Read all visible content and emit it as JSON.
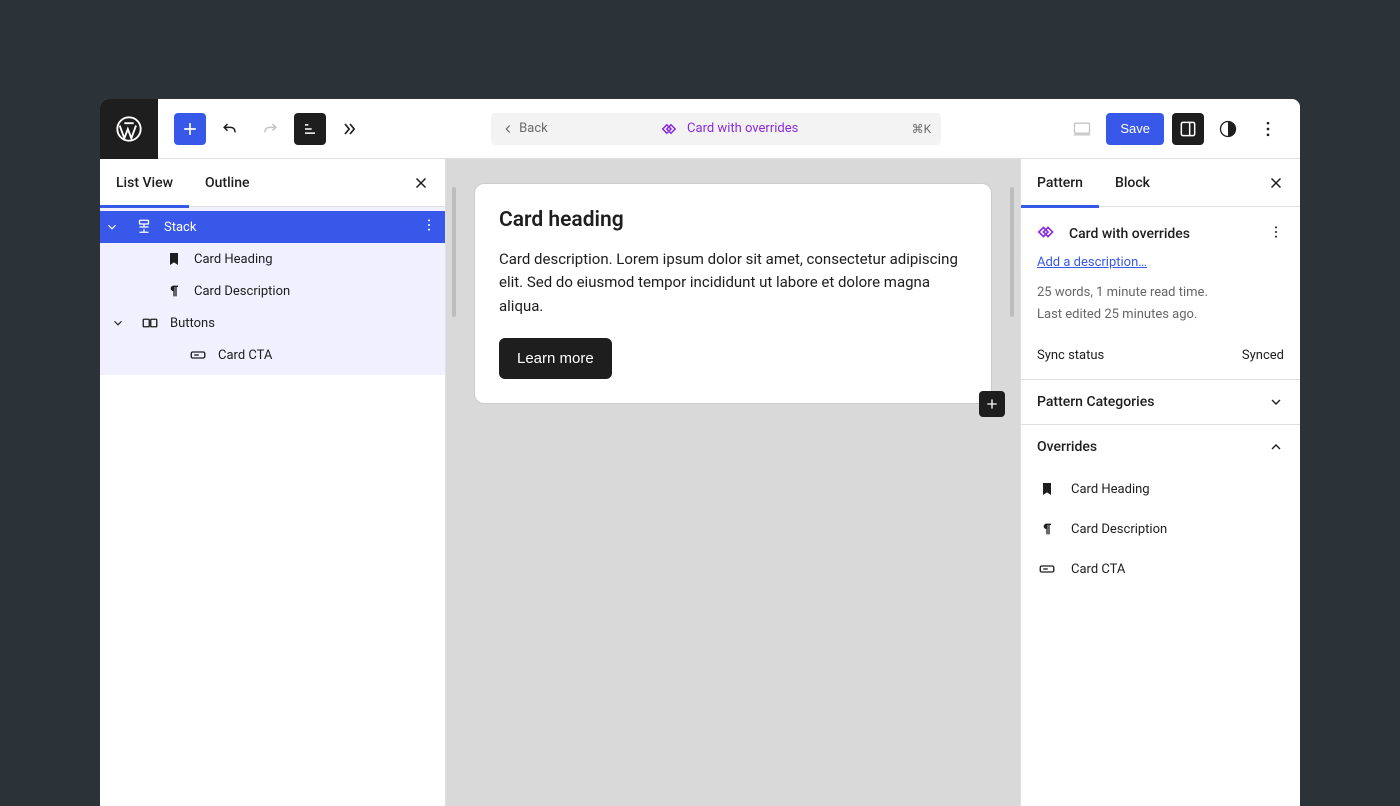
{
  "topbar": {
    "back_label": "Back",
    "pattern_title": "Card with overrides",
    "shortcut": "⌘K",
    "save_label": "Save"
  },
  "left_panel": {
    "tabs": {
      "list_view": "List View",
      "outline": "Outline"
    },
    "tree": [
      {
        "label": "Stack",
        "selected": true,
        "hasCaret": true
      },
      {
        "label": "Card Heading",
        "indent": 1,
        "icon": "bookmark"
      },
      {
        "label": "Card Description",
        "indent": 1,
        "icon": "paragraph"
      },
      {
        "label": "Buttons",
        "indent": 1,
        "icon": "group",
        "hasCaret": true
      },
      {
        "label": "Card CTA",
        "indent": 2,
        "icon": "button"
      }
    ]
  },
  "canvas": {
    "heading": "Card heading",
    "description": "Card description. Lorem ipsum dolor sit amet, consectetur adipiscing elit. Sed do eiusmod tempor incididunt ut labore et dolore magna aliqua.",
    "cta_label": "Learn more"
  },
  "right_panel": {
    "tabs": {
      "pattern": "Pattern",
      "block": "Block"
    },
    "pattern_name": "Card with overrides",
    "add_description": "Add a description…",
    "meta_line1": "25 words, 1 minute read time.",
    "meta_line2": "Last edited 25 minutes ago.",
    "sync_label": "Sync status",
    "sync_value": "Synced",
    "sections": {
      "categories": "Pattern Categories",
      "overrides": "Overrides"
    },
    "overrides": [
      {
        "label": "Card Heading",
        "icon": "bookmark"
      },
      {
        "label": "Card Description",
        "icon": "paragraph"
      },
      {
        "label": "Card CTA",
        "icon": "button"
      }
    ]
  }
}
